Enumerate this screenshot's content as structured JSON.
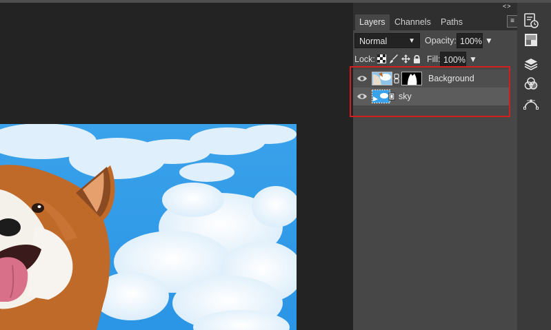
{
  "tabs": [
    {
      "label": "Layers",
      "active": true
    },
    {
      "label": "Channels",
      "active": false
    },
    {
      "label": "Paths",
      "active": false
    }
  ],
  "panel_menu_icon": "hamburger-menu-icon",
  "collapse_arrows": [
    "<>",
    "<>"
  ],
  "blend_mode": {
    "value": "Normal"
  },
  "opacity": {
    "label": "Opacity:",
    "value": "100%"
  },
  "lock": {
    "label": "Lock:",
    "icons": [
      "lock-transparency-icon",
      "lock-brush-icon",
      "lock-move-icon",
      "lock-all-icon"
    ]
  },
  "fill": {
    "label": "Fill:",
    "value": "100%"
  },
  "layers": [
    {
      "name": "Background",
      "visible": true,
      "has_mask": true
    },
    {
      "name": "sky",
      "visible": true,
      "selected": true
    }
  ],
  "right_toolbar": [
    "history-icon",
    "swatches-icon",
    "layers-icon",
    "channels-icon",
    "paths-icon"
  ],
  "colors": {
    "highlight_box": "#d21e1e",
    "panel_bg": "#474747",
    "app_bg": "#232323"
  }
}
